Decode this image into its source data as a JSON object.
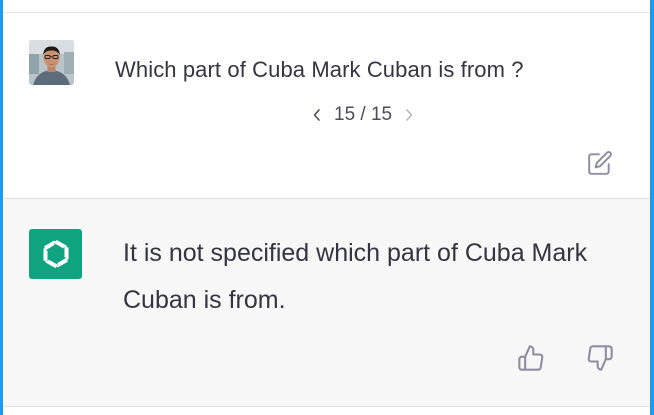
{
  "conversation": {
    "user_message": {
      "avatar_icon": "user-photo-avatar",
      "text": "Which part of Cuba Mark Cuban is from ?",
      "pager": {
        "current": "15",
        "separator": "/",
        "total": "15"
      },
      "edit_icon": "edit-icon"
    },
    "assistant_message": {
      "avatar_icon": "openai-logo-icon",
      "text": "It is not specified which part of Cuba Mark Cuban is from.",
      "feedback": {
        "thumbs_up_icon": "thumbs-up-icon",
        "thumbs_down_icon": "thumbs-down-icon"
      }
    }
  },
  "colors": {
    "accent_frame": "#1e9bf0",
    "assistant_bg": "#f7f7f8",
    "logo_bg": "#10a37f",
    "text": "#343541"
  }
}
